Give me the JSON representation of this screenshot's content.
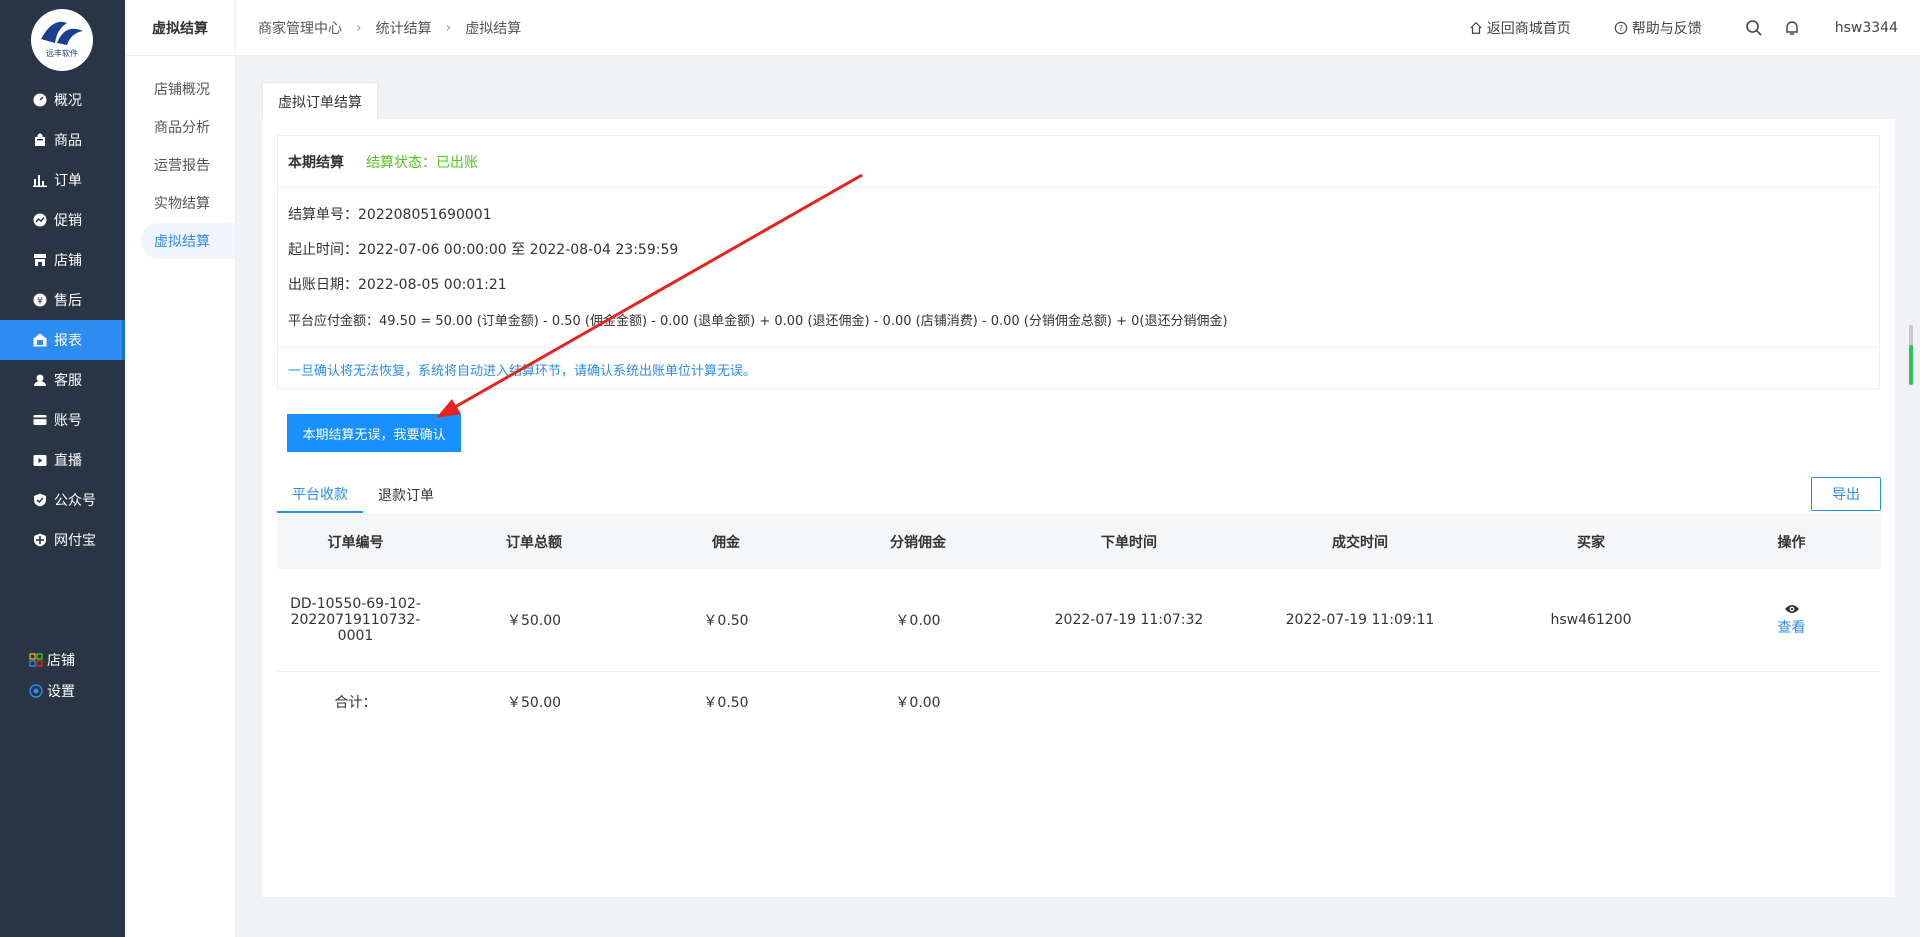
{
  "logo": {
    "text": "远丰软件"
  },
  "sidebar": {
    "items": [
      {
        "label": "概况",
        "icon": "dashboard-icon"
      },
      {
        "label": "商品",
        "icon": "bag-icon"
      },
      {
        "label": "订单",
        "icon": "bar-chart-icon"
      },
      {
        "label": "促销",
        "icon": "promo-icon"
      },
      {
        "label": "店铺",
        "icon": "store-icon"
      },
      {
        "label": "售后",
        "icon": "aftersale-icon"
      },
      {
        "label": "报表",
        "icon": "report-icon"
      },
      {
        "label": "客服",
        "icon": "headset-icon"
      },
      {
        "label": "账号",
        "icon": "card-icon"
      },
      {
        "label": "直播",
        "icon": "live-icon"
      },
      {
        "label": "公众号",
        "icon": "shield-check-icon"
      },
      {
        "label": "网付宝",
        "icon": "shield-icon"
      }
    ],
    "active_index": 6,
    "bottom": [
      {
        "label": "店铺",
        "icon": "grid-icon"
      },
      {
        "label": "设置",
        "icon": "settings-icon"
      }
    ]
  },
  "subnav": {
    "title": "虚拟结算",
    "items": [
      "店铺概况",
      "商品分析",
      "运营报告",
      "实物结算",
      "虚拟结算"
    ],
    "active_index": 4
  },
  "header": {
    "breadcrumb": [
      "商家管理中心",
      "统计结算",
      "虚拟结算"
    ],
    "home_link": "返回商城首页",
    "help_link": "帮助与反馈",
    "username": "hsw3344"
  },
  "page_tab": "虚拟订单结算",
  "settlement": {
    "title": "本期结算",
    "status": "结算状态：已出账",
    "number": "结算单号：202208051690001",
    "period": "起止时间：2022-07-06 00:00:00 至 2022-08-04 23:59:59",
    "bill_date": "出账日期：2022-08-05 00:01:21",
    "formula": "平台应付金额：49.50 = 50.00 (订单金额) - 0.50 (佣金金额) - 0.00 (退单金额) + 0.00 (退还佣金) - 0.00 (店铺消费) - 0.00 (分销佣金总额) + 0(退还分销佣金)",
    "notice": "一旦确认将无法恢复，系统将自动进入结算环节，请确认系统出账单位计算无误。",
    "confirm_button": "本期结算无误，我要确认"
  },
  "tabs": [
    "平台收款",
    "退款订单"
  ],
  "active_tab": 0,
  "export_button": "导出",
  "table": {
    "headers": [
      "订单编号",
      "订单总额",
      "佣金",
      "分销佣金",
      "下单时间",
      "成交时间",
      "买家",
      "操作"
    ],
    "rows": [
      {
        "order_no_1": "DD-10550-69-102-",
        "order_no_2": "20220719110732-",
        "order_no_3": "0001",
        "total": "￥50.00",
        "commission": "￥0.50",
        "dist_commission": "￥0.00",
        "order_time": "2022-07-19 11:07:32",
        "deal_time": "2022-07-19 11:09:11",
        "buyer": "hsw461200",
        "action": "查看"
      }
    ],
    "summary": {
      "label": "合计：",
      "total": "￥50.00",
      "commission": "￥0.50",
      "dist_commission": "￥0.00"
    }
  },
  "colors": {
    "sidebar_bg": "#293544",
    "accent": "#1890ff",
    "status_green": "#52c41a",
    "arrow": "#e8231d"
  }
}
